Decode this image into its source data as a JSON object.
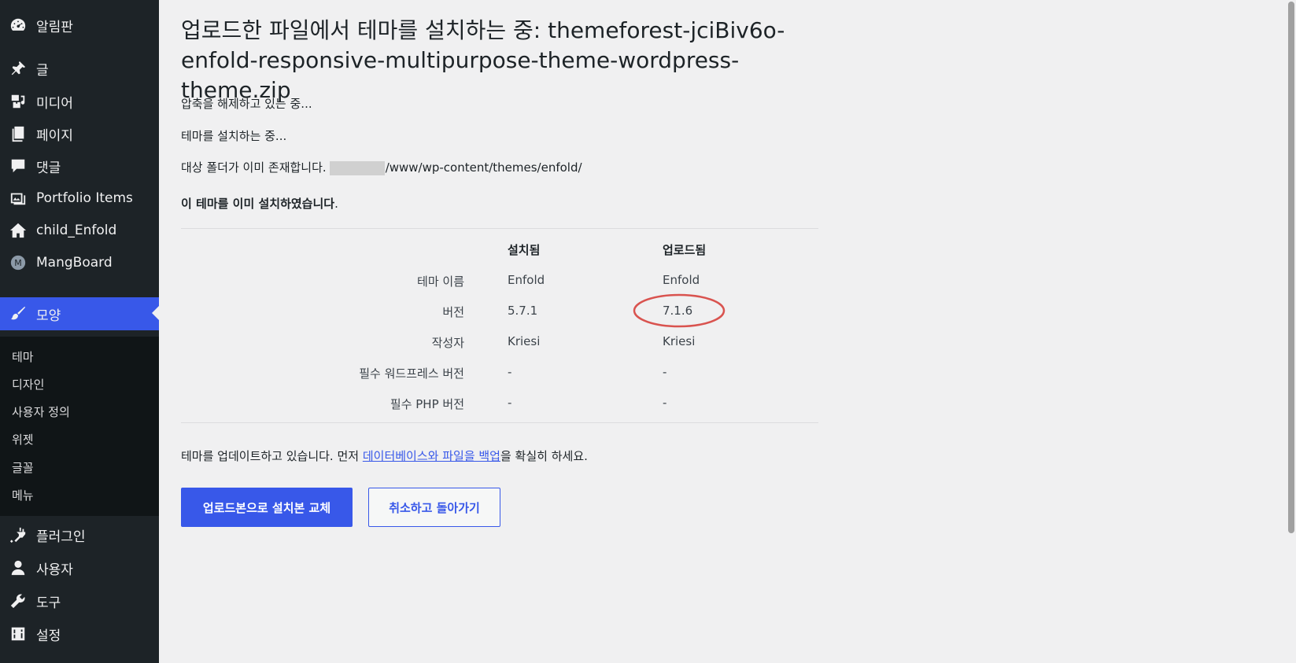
{
  "sidebar": {
    "items": [
      {
        "label": "알림판",
        "icon": "dashboard-icon"
      },
      {
        "label": "글",
        "icon": "pushpin-icon"
      },
      {
        "label": "미디어",
        "icon": "media-icon"
      },
      {
        "label": "페이지",
        "icon": "pages-icon"
      },
      {
        "label": "댓글",
        "icon": "comment-icon"
      },
      {
        "label": "Portfolio Items",
        "icon": "portfolio-icon"
      },
      {
        "label": "child_Enfold",
        "icon": "home-icon"
      },
      {
        "label": "MangBoard",
        "icon": "mangboard-logo-icon"
      },
      {
        "label": "모양",
        "icon": "paintbrush-icon",
        "active": true
      },
      {
        "label": "플러그인",
        "icon": "plugin-icon"
      },
      {
        "label": "사용자",
        "icon": "user-icon"
      },
      {
        "label": "도구",
        "icon": "wrench-icon"
      },
      {
        "label": "설정",
        "icon": "settings-icon"
      }
    ],
    "submenu": [
      "테마",
      "디자인",
      "사용자 정의",
      "위젯",
      "글꼴",
      "메뉴"
    ]
  },
  "main": {
    "title": "업로드한 파일에서 테마를 설치하는 중: themeforest-jciBiv6o-enfold-responsive-multipurpose-theme-wordpress-theme.zip",
    "messages": {
      "unpacking": "압축을 해제하고 있는 중...",
      "installing": "테마를 설치하는 중...",
      "folder_exists_prefix": "대상 폴더가 이미 존재합니다.",
      "folder_exists_path": "/www/wp-content/themes/enfold/",
      "already_installed": "이 테마를 이미 설치하였습니다",
      "already_installed_period": "."
    },
    "table": {
      "headers": {
        "installed": "설치됨",
        "uploaded": "업로드됨"
      },
      "rows": [
        {
          "label": "테마 이름",
          "installed": "Enfold",
          "uploaded": "Enfold"
        },
        {
          "label": "버전",
          "installed": "5.7.1",
          "uploaded": "7.1.6"
        },
        {
          "label": "작성자",
          "installed": "Kriesi",
          "uploaded": "Kriesi"
        },
        {
          "label": "필수 워드프레스 버전",
          "installed": "-",
          "uploaded": "-"
        },
        {
          "label": "필수 PHP 버전",
          "installed": "-",
          "uploaded": "-"
        }
      ]
    },
    "notice": {
      "prefix": "테마를 업데이트하고 있습니다. 먼저 ",
      "link": "데이터베이스와 파일을 백업",
      "suffix": "을 확실히 하세요."
    },
    "buttons": {
      "replace": "업로드본으로 설치본 교체",
      "cancel": "취소하고 돌아가기"
    }
  },
  "colors": {
    "accent": "#3858e9",
    "sidebar_bg": "#1d2327",
    "submenu_bg": "#101517",
    "annotation": "#d9534f"
  }
}
